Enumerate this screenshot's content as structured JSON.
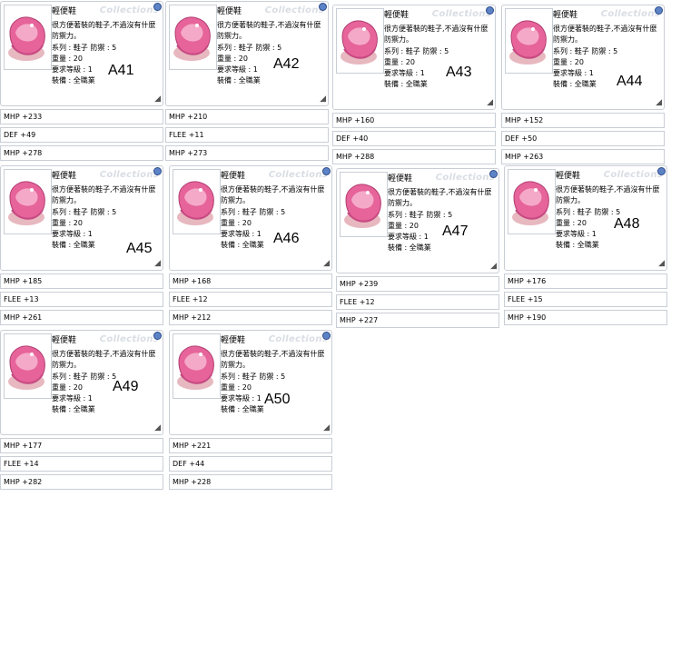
{
  "shared": {
    "item_name": "輕便鞋",
    "watermark": "Collections",
    "description": "很方便著裝的鞋子,不過沒有什麼防禦力。",
    "series": "系列 : 鞋子  防禦 : 5",
    "weight": "重量 : 20",
    "required_level": "要求等級 : 1",
    "equip": "裝備 : 全職業",
    "resize_glyph": "◢"
  },
  "cards": [
    {
      "label": "A41",
      "options": [
        "MHP +233",
        "DEF +49",
        "MHP +278"
      ]
    },
    {
      "label": "A42",
      "options": [
        "MHP +210",
        "FLEE +11",
        "MHP +273"
      ]
    },
    {
      "label": "A43",
      "options": [
        "MHP +160",
        "DEF +40",
        "MHP +288"
      ]
    },
    {
      "label": "A44",
      "options": [
        "MHP +152",
        "DEF +50",
        "MHP +263"
      ]
    },
    {
      "label": "A45",
      "options": [
        "MHP +185",
        "FLEE +13",
        "MHP +261"
      ]
    },
    {
      "label": "A46",
      "options": [
        "MHP +168",
        "FLEE +12",
        "MHP +212"
      ]
    },
    {
      "label": "A47",
      "options": [
        "MHP +239",
        "FLEE +12",
        "MHP +227"
      ]
    },
    {
      "label": "A48",
      "options": [
        "MHP +176",
        "FLEE +15",
        "MHP +190"
      ]
    },
    {
      "label": "A49",
      "options": [
        "MHP +177",
        "FLEE +14",
        "MHP +282"
      ]
    },
    {
      "label": "A50",
      "options": [
        "MHP +221",
        "DEF +44",
        "MHP +228"
      ]
    }
  ]
}
